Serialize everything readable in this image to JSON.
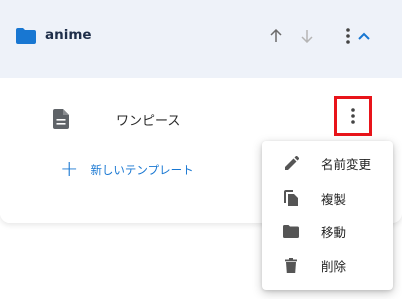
{
  "folder": {
    "name": "anime",
    "icon": "folder-icon",
    "accent_color": "#1877d2"
  },
  "header_actions": {
    "move_up_icon": "arrow-up-icon",
    "move_down_icon": "arrow-down-icon",
    "more_icon": "more-vert-icon",
    "collapse_icon": "chevron-up-icon"
  },
  "templates": [
    {
      "name": "ワンピース",
      "icon": "file-icon"
    }
  ],
  "add_template": {
    "label": "新しいテンプレート",
    "icon": "plus-icon"
  },
  "context_menu": {
    "items": [
      {
        "label": "名前変更",
        "icon": "pencil-icon"
      },
      {
        "label": "複製",
        "icon": "copy-icon"
      },
      {
        "label": "移動",
        "icon": "folder-icon"
      },
      {
        "label": "削除",
        "icon": "trash-icon"
      }
    ]
  },
  "highlight_color": "#e8141a"
}
